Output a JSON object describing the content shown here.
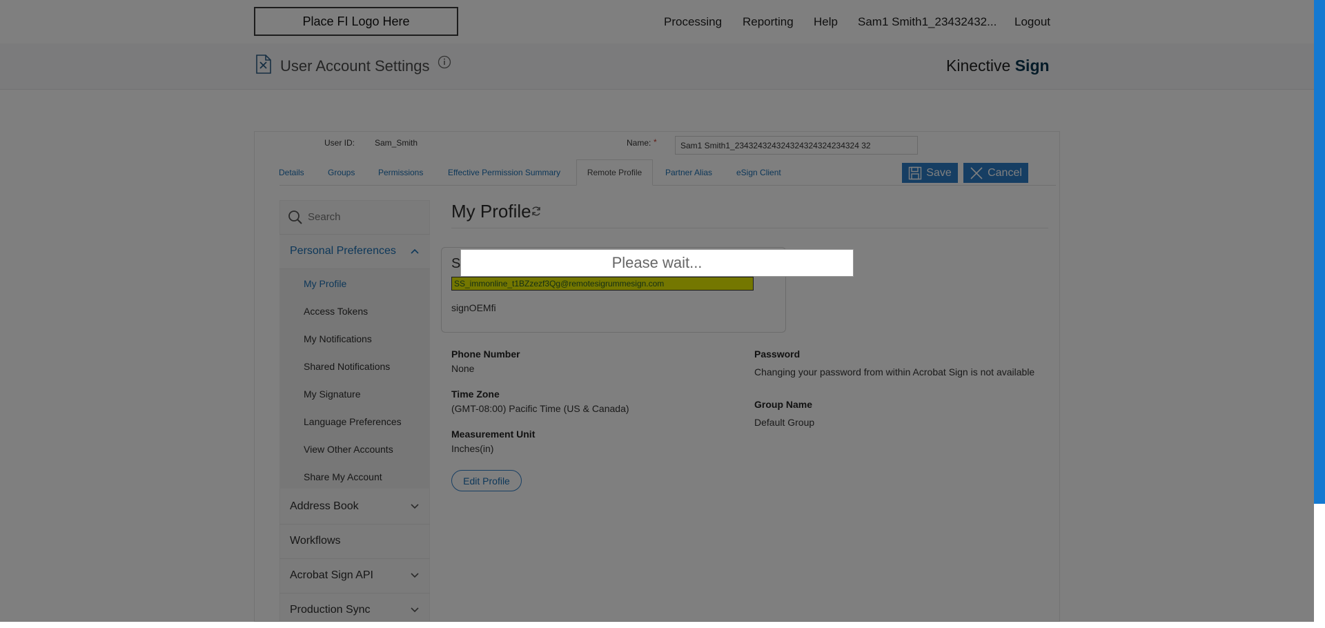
{
  "header": {
    "logo_placeholder": "Place FI Logo Here",
    "nav": [
      "Processing",
      "Reporting",
      "Help",
      "Sam1 Smith1_23432432...",
      "Logout"
    ]
  },
  "subheader": {
    "title": "User Account Settings",
    "brand_regular": "Kinective",
    "brand_bold": "Sign"
  },
  "user": {
    "user_id_label": "User ID:",
    "user_id_value": "Sam_Smith",
    "name_label": "Name:",
    "required_mark": "*",
    "name_value": "Sam1 Smith1_234324324324324324324234324 32"
  },
  "tabs": [
    {
      "label": "Details"
    },
    {
      "label": "Groups"
    },
    {
      "label": "Permissions"
    },
    {
      "label": "Effective Permission Summary"
    },
    {
      "label": "Remote Profile",
      "active": true
    },
    {
      "label": "Partner Alias"
    },
    {
      "label": "eSign Client"
    }
  ],
  "actions": {
    "save": "Save",
    "cancel": "Cancel"
  },
  "sidebar": {
    "search_placeholder": "Search",
    "sections": [
      {
        "label": "Personal Preferences",
        "expanded": true,
        "items": [
          "My Profile",
          "Access Tokens",
          "My Notifications",
          "Shared Notifications",
          "My Signature",
          "Language Preferences",
          "View Other Accounts",
          "Share My Account"
        ],
        "selected": "My Profile"
      },
      {
        "label": "Address Book"
      },
      {
        "label": "Workflows"
      },
      {
        "label": "Acrobat Sign API"
      },
      {
        "label": "Production Sync"
      }
    ]
  },
  "profile": {
    "heading": "My Profile",
    "card_initial": "S",
    "email": "SS_immonline_t1BZzezf3Qg@remotesigrummesign.com",
    "account": "signOEMfi",
    "phone_label": "Phone Number",
    "phone_value": "None",
    "timezone_label": "Time Zone",
    "timezone_value": "(GMT-08:00) Pacific Time (US & Canada)",
    "measure_label": "Measurement Unit",
    "measure_value": "Inches(in)",
    "password_label": "Password",
    "password_value": "Changing your password from within Acrobat Sign is not available",
    "group_label": "Group Name",
    "group_value": "Default Group",
    "edit_label": "Edit Profile"
  },
  "modal": {
    "text": "Please wait..."
  },
  "colors": {
    "accent": "#2d7dc7",
    "brand_dark": "#08344f",
    "highlight": "#e8ef00"
  }
}
